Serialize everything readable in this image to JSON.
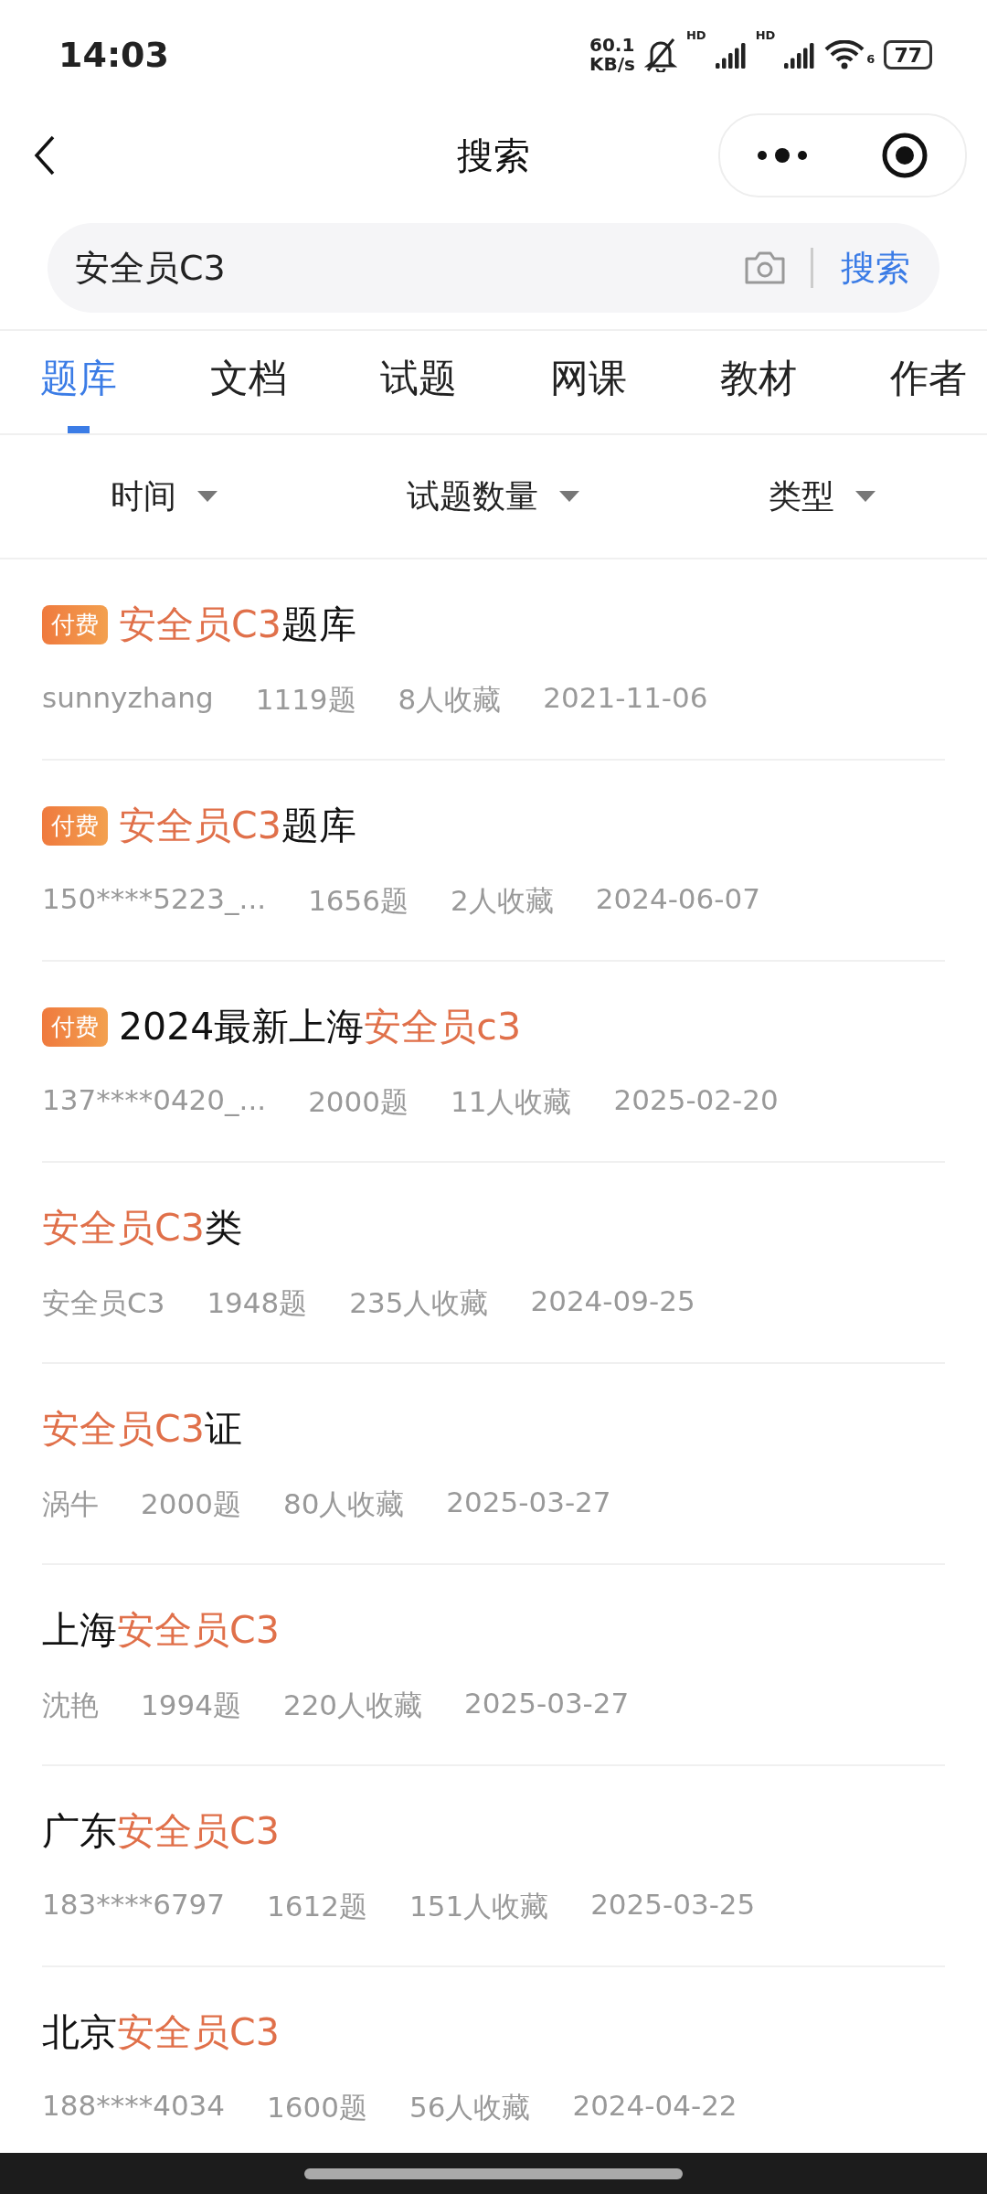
{
  "status_bar": {
    "time": "14:03",
    "net_speed": "60.1",
    "net_unit": "KB/s",
    "signal_labels": [
      "HD",
      "HD"
    ],
    "wifi_label": "6",
    "battery": "77"
  },
  "nav": {
    "title": "搜索"
  },
  "search": {
    "value": "安全员C3",
    "button": "搜索"
  },
  "tabs": [
    {
      "label": "题库",
      "selected": true
    },
    {
      "label": "文档",
      "selected": false
    },
    {
      "label": "试题",
      "selected": false
    },
    {
      "label": "网课",
      "selected": false
    },
    {
      "label": "教材",
      "selected": false
    },
    {
      "label": "作者",
      "selected": false
    }
  ],
  "filters": [
    {
      "label": "时间"
    },
    {
      "label": "试题数量"
    },
    {
      "label": "类型"
    }
  ],
  "results": [
    {
      "badge": "付费",
      "title": [
        {
          "text": "安全员C3",
          "highlight": true
        },
        {
          "text": "题库",
          "highlight": false
        }
      ],
      "author": "sunnyzhang",
      "count": "1119题",
      "favorites": "8人收藏",
      "date": "2021-11-06"
    },
    {
      "badge": "付费",
      "title": [
        {
          "text": "安全员C3",
          "highlight": true
        },
        {
          "text": "题库",
          "highlight": false
        }
      ],
      "author": "150****5223_...",
      "count": "1656题",
      "favorites": "2人收藏",
      "date": "2024-06-07"
    },
    {
      "badge": "付费",
      "title": [
        {
          "text": "2024最新上海",
          "highlight": false
        },
        {
          "text": "安全员c3",
          "highlight": true
        }
      ],
      "author": "137****0420_...",
      "count": "2000题",
      "favorites": "11人收藏",
      "date": "2025-02-20"
    },
    {
      "title": [
        {
          "text": "安全员C3",
          "highlight": true
        },
        {
          "text": "类",
          "highlight": false
        }
      ],
      "author": "安全员C3",
      "count": "1948题",
      "favorites": "235人收藏",
      "date": "2024-09-25"
    },
    {
      "title": [
        {
          "text": "安全员C3",
          "highlight": true
        },
        {
          "text": "证",
          "highlight": false
        }
      ],
      "author": "涡牛",
      "count": "2000题",
      "favorites": "80人收藏",
      "date": "2025-03-27"
    },
    {
      "title": [
        {
          "text": "上海",
          "highlight": false
        },
        {
          "text": "安全员C3",
          "highlight": true
        }
      ],
      "author": "沈艳",
      "count": "1994题",
      "favorites": "220人收藏",
      "date": "2025-03-27"
    },
    {
      "title": [
        {
          "text": "广东",
          "highlight": false
        },
        {
          "text": "安全员C3",
          "highlight": true
        }
      ],
      "author": "183****6797",
      "count": "1612题",
      "favorites": "151人收藏",
      "date": "2025-03-25"
    },
    {
      "title": [
        {
          "text": "北京",
          "highlight": false
        },
        {
          "text": "安全员C3",
          "highlight": true
        }
      ],
      "author": "188****4034",
      "count": "1600题",
      "favorites": "56人收藏",
      "date": "2024-04-22"
    }
  ]
}
